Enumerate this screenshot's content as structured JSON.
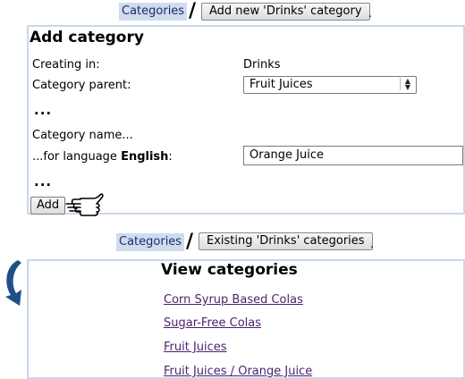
{
  "top_crumb": {
    "link": "Categories",
    "separator": "/",
    "button": "Add new 'Drinks' category",
    "trail": "."
  },
  "add_panel": {
    "title": "Add category",
    "creating_in_label": "Creating in:",
    "creating_in_value": "Drinks",
    "parent_label": "Category parent:",
    "parent_value": "Fruit Juices",
    "ellipsis": "...",
    "name_label": "Category name...",
    "lang_prefix": "...for language ",
    "lang_name": "English",
    "lang_suffix": ":",
    "name_value": "Orange Juice",
    "add_button": "Add"
  },
  "bottom_crumb": {
    "link": "Categories",
    "separator": "/",
    "button": "Existing 'Drinks' categories",
    "trail": "."
  },
  "view_panel": {
    "title": "View categories",
    "items": [
      {
        "label": "Corn Syrup Based Colas"
      },
      {
        "label": "Sugar-Free Colas"
      },
      {
        "label": "Fruit Juices"
      },
      {
        "label": "Fruit Juices / Orange Juice"
      }
    ]
  },
  "icons": {
    "pointer": "hand-pointer-icon",
    "arrow": "curved-arrow-icon"
  },
  "colors": {
    "panel_border": "#c8d8ec",
    "link_bg": "#cfdcee",
    "link_text": "#4b1f6e",
    "arrow": "#1f4f8a"
  }
}
